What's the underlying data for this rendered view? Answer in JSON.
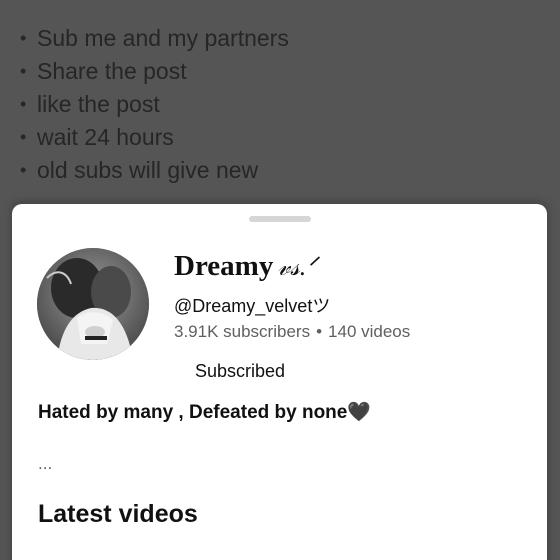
{
  "post": {
    "bullet_glyph": "•",
    "lines": [
      "Sub me and my partners",
      "Share the post",
      "like the post",
      "wait 24 hours",
      "old subs will give new"
    ]
  },
  "channel": {
    "name": "Dreamy",
    "name_signature": "𝓋𝓈.ᐟ",
    "handle": "@Dreamy_velvetツ",
    "subscribers": "3.91K subscribers",
    "separator": "•",
    "videos": "140 videos",
    "subscribe_button_label": "Subscribed",
    "description": "Hated by many , Defeated by none🖤",
    "more_label": "...",
    "latest_videos_title": "Latest videos"
  },
  "colors": {
    "overlay_background": "#555555",
    "sheet_background": "#ffffff",
    "primary_text": "#111111",
    "secondary_text": "#606060"
  }
}
